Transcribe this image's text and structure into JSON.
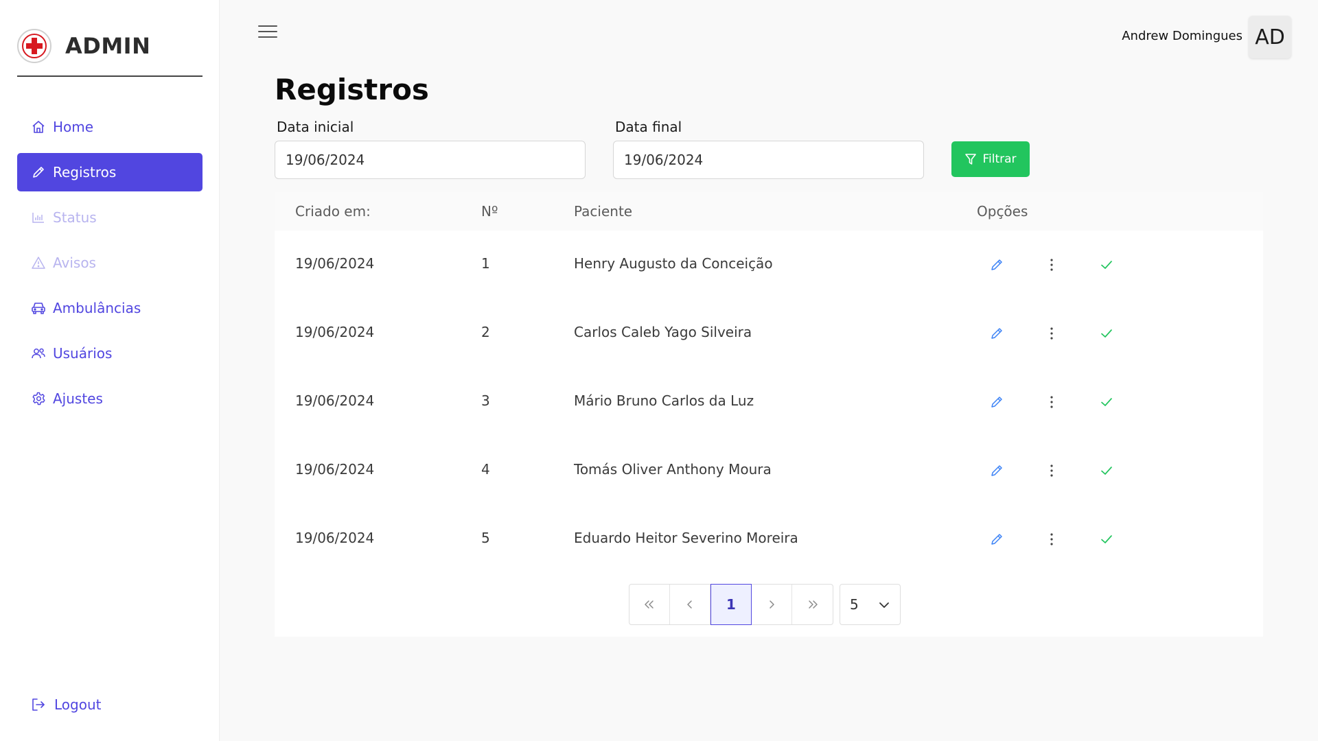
{
  "brand": {
    "title": "ADMIN",
    "logo_icon": "red-cross-icon"
  },
  "sidebar": {
    "items": [
      {
        "label": "Home",
        "icon": "home-icon",
        "state": "normal"
      },
      {
        "label": "Registros",
        "icon": "pencil-icon",
        "state": "active"
      },
      {
        "label": "Status",
        "icon": "bar-chart-icon",
        "state": "disabled"
      },
      {
        "label": "Avisos",
        "icon": "warning-icon",
        "state": "disabled"
      },
      {
        "label": "Ambulâncias",
        "icon": "car-icon",
        "state": "normal"
      },
      {
        "label": "Usuários",
        "icon": "users-icon",
        "state": "normal"
      },
      {
        "label": "Ajustes",
        "icon": "gear-icon",
        "state": "normal"
      }
    ],
    "logout_label": "Logout"
  },
  "header": {
    "user_name": "Andrew Domingues",
    "avatar_initials": "AD"
  },
  "page": {
    "title": "Registros",
    "filters": {
      "start_label": "Data inicial",
      "start_value": "19/06/2024",
      "end_label": "Data final",
      "end_value": "19/06/2024",
      "filter_button": "Filtrar"
    }
  },
  "table": {
    "columns": [
      "Criado em:",
      "Nº",
      "Paciente",
      "Opções"
    ],
    "rows": [
      {
        "created": "19/06/2024",
        "number": "1",
        "patient": "Henry Augusto da Conceição"
      },
      {
        "created": "19/06/2024",
        "number": "2",
        "patient": "Carlos Caleb Yago Silveira"
      },
      {
        "created": "19/06/2024",
        "number": "3",
        "patient": "Mário Bruno Carlos da Luz"
      },
      {
        "created": "19/06/2024",
        "number": "4",
        "patient": "Tomás Oliver Anthony Moura"
      },
      {
        "created": "19/06/2024",
        "number": "5",
        "patient": "Eduardo Heitor Severino Moreira"
      }
    ]
  },
  "pagination": {
    "current_page": "1",
    "page_size": "5"
  },
  "colors": {
    "primary": "#5146e0",
    "success": "#22c55e",
    "edit_icon": "#3b82f6",
    "brand_red": "#d71920"
  }
}
